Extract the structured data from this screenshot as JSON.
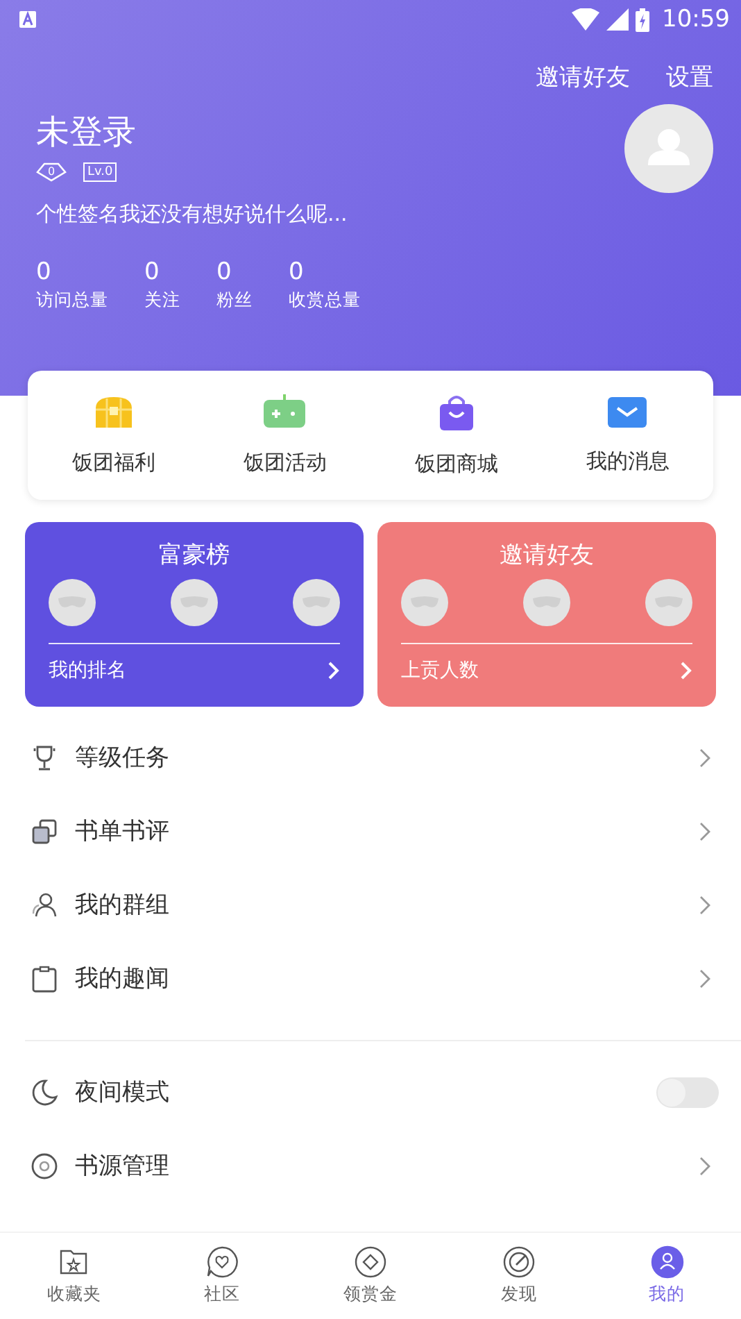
{
  "status_bar": {
    "time": "10:59"
  },
  "header": {
    "actions": [
      "邀请好友",
      "设置"
    ],
    "username": "未登录",
    "gem_count": "0",
    "level": "Lv.0",
    "signature": "个性签名我还没有想好说什么呢...",
    "stats": [
      {
        "value": "0",
        "label": "访问总量"
      },
      {
        "value": "0",
        "label": "关注"
      },
      {
        "value": "0",
        "label": "粉丝"
      },
      {
        "value": "0",
        "label": "收赏总量"
      }
    ]
  },
  "quick_links": [
    "饭团福利",
    "饭团活动",
    "饭团商城",
    "我的消息"
  ],
  "rank_cards": [
    {
      "title": "富豪榜",
      "footer": "我的排名",
      "color": "#5f50e0"
    },
    {
      "title": "邀请好友",
      "footer": "上贡人数",
      "color": "#f07b7b"
    }
  ],
  "menu": [
    {
      "label": "等级任务",
      "kind": "link"
    },
    {
      "label": "书单书评",
      "kind": "link"
    },
    {
      "label": "我的群组",
      "kind": "link"
    },
    {
      "label": "我的趣闻",
      "kind": "link"
    }
  ],
  "settings": [
    {
      "label": "夜间模式",
      "kind": "toggle",
      "on": false
    },
    {
      "label": "书源管理",
      "kind": "link"
    }
  ],
  "tabs": [
    {
      "label": "收藏夹",
      "selected": false
    },
    {
      "label": "社区",
      "selected": false
    },
    {
      "label": "领赏金",
      "selected": false
    },
    {
      "label": "发现",
      "selected": false
    },
    {
      "label": "我的",
      "selected": true
    }
  ]
}
